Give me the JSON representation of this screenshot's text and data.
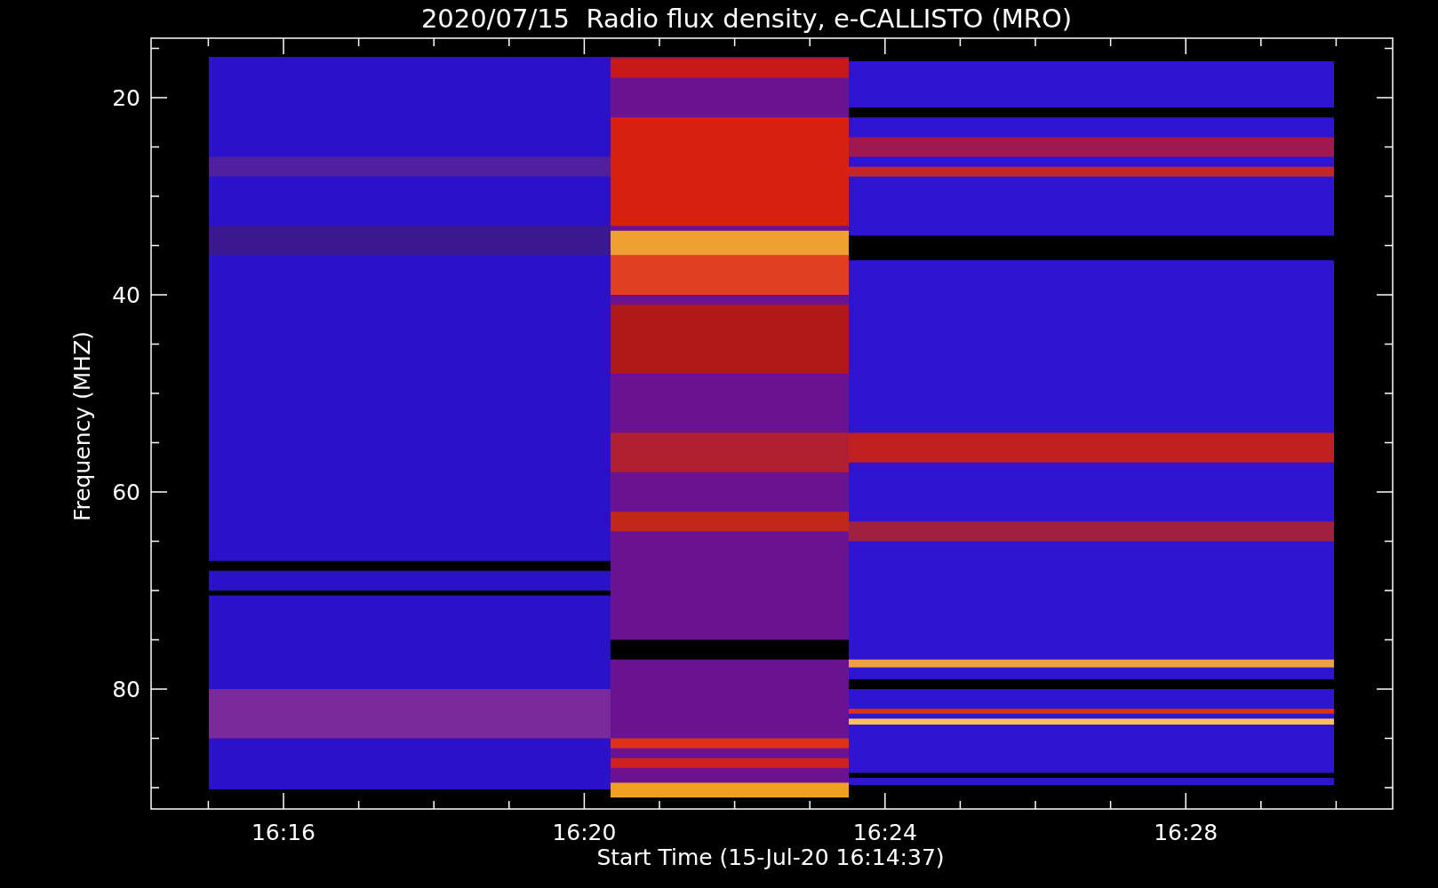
{
  "title": "2020/07/15  Radio flux density, e-CALLISTO (MRO)",
  "y_axis": {
    "label": "Frequency (MHZ)",
    "ticks": [
      "20",
      "40",
      "60",
      "80"
    ]
  },
  "x_axis": {
    "label": "Start Time (15-Jul-20 16:14:37)",
    "ticks": [
      "16:16",
      "16:20",
      "16:24",
      "16:28"
    ]
  }
}
